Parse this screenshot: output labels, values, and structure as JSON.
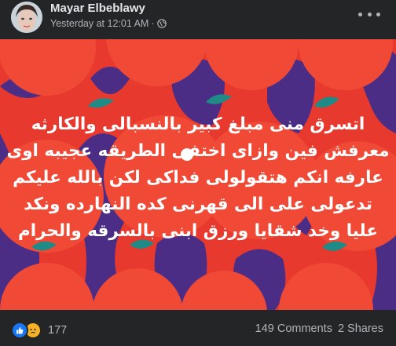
{
  "post": {
    "author": "Mayar Elbeblawy",
    "timestamp": "Yesterday at 12:01 AM",
    "separator": "·",
    "privacy_icon": "globe-icon",
    "more_icon": "more-options-icon",
    "image_text": [
      "اتسرق منى مبلغ كبير بالنسبالى والكارثه",
      "معرفش فين وازاى اختفى الطريقه عجيبه اوى",
      "عارفه انكم هتقولولى فداكى لكن بالله عليكم",
      "تدعولى على الى قهرنى كده النهارده ونكد",
      "عليا وخد شقايا ورزق ابنى بالسرقه والحرام"
    ]
  },
  "reactions": {
    "icons": [
      "like-icon",
      "sad-icon"
    ],
    "count": "177"
  },
  "stats": {
    "comments": "149 Comments",
    "shares": "2 Shares"
  },
  "colors": {
    "background": "#242526",
    "image_bg": "#e8392e",
    "orange": "#f04a36",
    "purple": "#4b2d86",
    "leaf": "#1f8a86",
    "like": "#1877f2",
    "sad": "#f7b125"
  }
}
